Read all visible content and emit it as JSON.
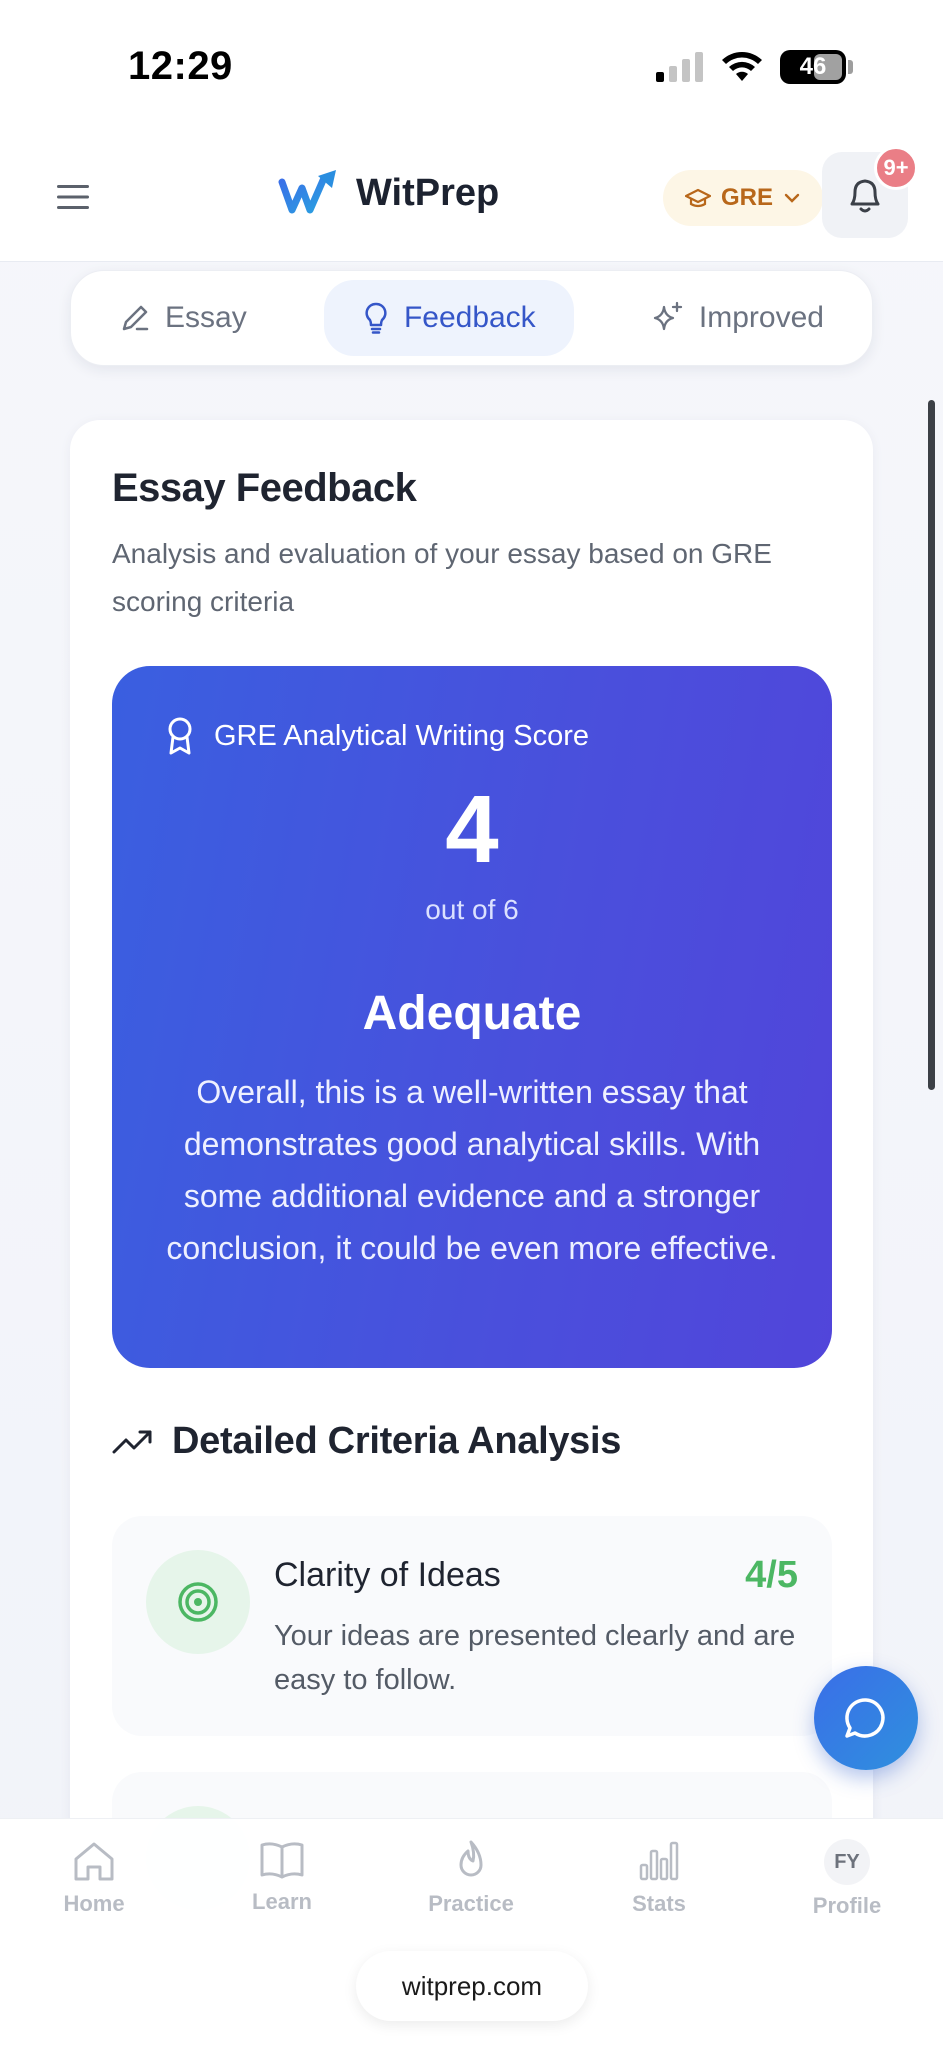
{
  "status_bar": {
    "time": "12:29",
    "battery": "46"
  },
  "header": {
    "brand": "WitPrep",
    "exam": "GRE",
    "notifications": "9+"
  },
  "tabs": [
    {
      "label": "Essay",
      "icon": "pencil-icon"
    },
    {
      "label": "Feedback",
      "icon": "lightbulb-icon",
      "active": true
    },
    {
      "label": "Improved",
      "icon": "sparkles-icon"
    }
  ],
  "feedback": {
    "title": "Essay Feedback",
    "subtitle": "Analysis and evaluation of your essay based on GRE scoring criteria",
    "score_heading": "GRE Analytical Writing Score",
    "score": "4",
    "scale": "out of 6",
    "level": "Adequate",
    "summary": "Overall, this is a well-written essay that demonstrates good analytical skills. With some additional evidence and a stronger conclusion, it could be even more effective."
  },
  "criteria_section": {
    "title": "Detailed Criteria Analysis",
    "items": [
      {
        "name": "Clarity of Ideas",
        "score": "4/5",
        "description": "Your ideas are presented clearly and are easy to follow."
      }
    ]
  },
  "bottom_nav": [
    {
      "label": "Home"
    },
    {
      "label": "Learn"
    },
    {
      "label": "Practice"
    },
    {
      "label": "Stats"
    },
    {
      "label": "Profile",
      "avatar": "FY"
    }
  ],
  "browser": {
    "url": "witprep.com"
  },
  "colors": {
    "primary": "#3a5fe0",
    "accent_green": "#4cb763",
    "badge": "#ea7e86",
    "exam_pill": "#b8671a"
  }
}
